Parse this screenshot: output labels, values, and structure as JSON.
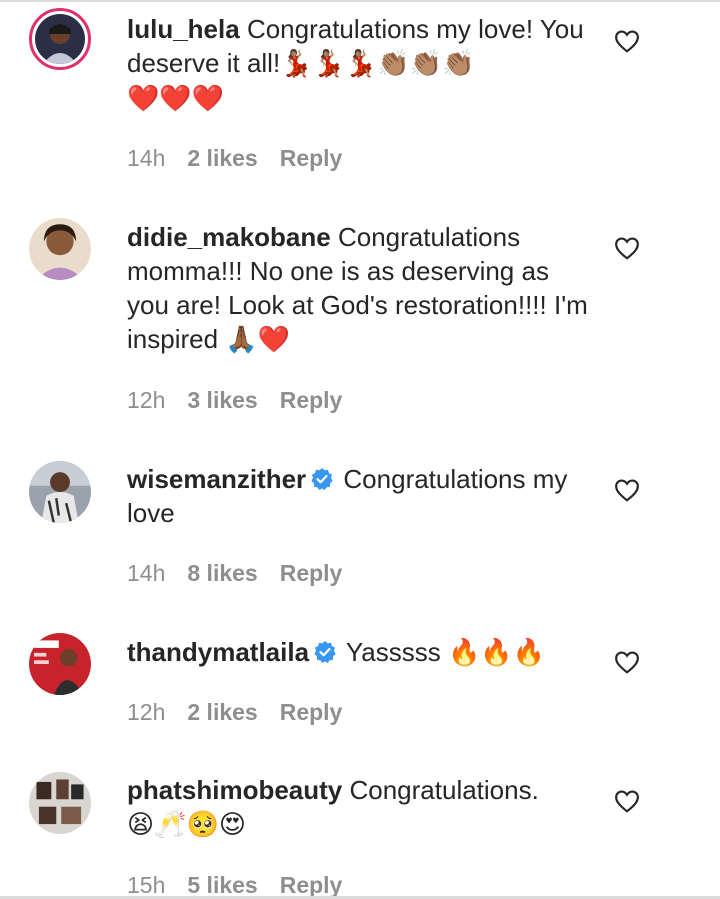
{
  "comments": [
    {
      "username": "lulu_hela",
      "verified": false,
      "text": "Congratulations my love! You deserve it all!",
      "emojis": "💃🏽💃🏽💃🏽👏🏽👏🏽👏🏽",
      "emojis2": "❤️❤️❤️",
      "time": "14h",
      "likes": "2 likes",
      "reply": "Reply"
    },
    {
      "username": "didie_makobane",
      "verified": false,
      "text": "Congratulations momma!!! No one is as deserving as you are! Look at God's restoration!!!! I'm inspired",
      "emojis": "🙏🏾❤️",
      "time": "12h",
      "likes": "3 likes",
      "reply": "Reply"
    },
    {
      "username": "wisemanzither",
      "verified": true,
      "text": "Congratulations my love",
      "time": "14h",
      "likes": "8 likes",
      "reply": "Reply"
    },
    {
      "username": "thandymatlaila",
      "verified": true,
      "text": "Yasssss",
      "emojis": "🔥🔥🔥",
      "time": "12h",
      "likes": "2 likes",
      "reply": "Reply"
    },
    {
      "username": "phatshimobeauty",
      "verified": false,
      "text": "Congratulations.",
      "emojis": "😫🥂🥺😍",
      "time": "15h",
      "likes": "5 likes",
      "reply": "Reply"
    }
  ],
  "colors": {
    "text": "#262626",
    "meta": "#8e8e8e",
    "verified": "#3897f0",
    "story_ring": "#e1306c"
  },
  "icons": {
    "like": "heart-outline-icon",
    "verified": "verified-badge-icon"
  }
}
